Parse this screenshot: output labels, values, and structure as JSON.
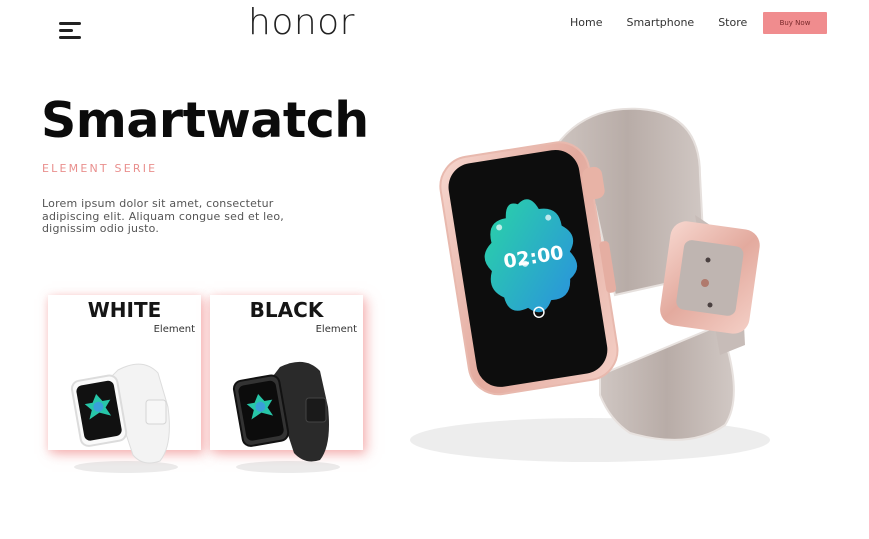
{
  "header": {
    "logo_text": "honor",
    "nav": [
      "Home",
      "Smartphone",
      "Store"
    ],
    "buy_button": "Buy Now"
  },
  "hero": {
    "title": "Smartwatch",
    "subtitle": "ELEMENT SERIE",
    "description": "Lorem ipsum dolor sit amet, consectetur adipiscing elit. Aliquam congue sed et leo, dignissim odio justo."
  },
  "variants": [
    {
      "name": "WHITE",
      "tag": "Element"
    },
    {
      "name": "BLACK",
      "tag": "Element"
    }
  ],
  "watch_screen": {
    "time": "02:00"
  },
  "colors": {
    "accent": "#f08c8e",
    "subtitle": "#e98f8d",
    "rose_gold": "#e7b8ae",
    "strap": "#bdb2ae"
  },
  "icons": [
    "menu-icon"
  ]
}
